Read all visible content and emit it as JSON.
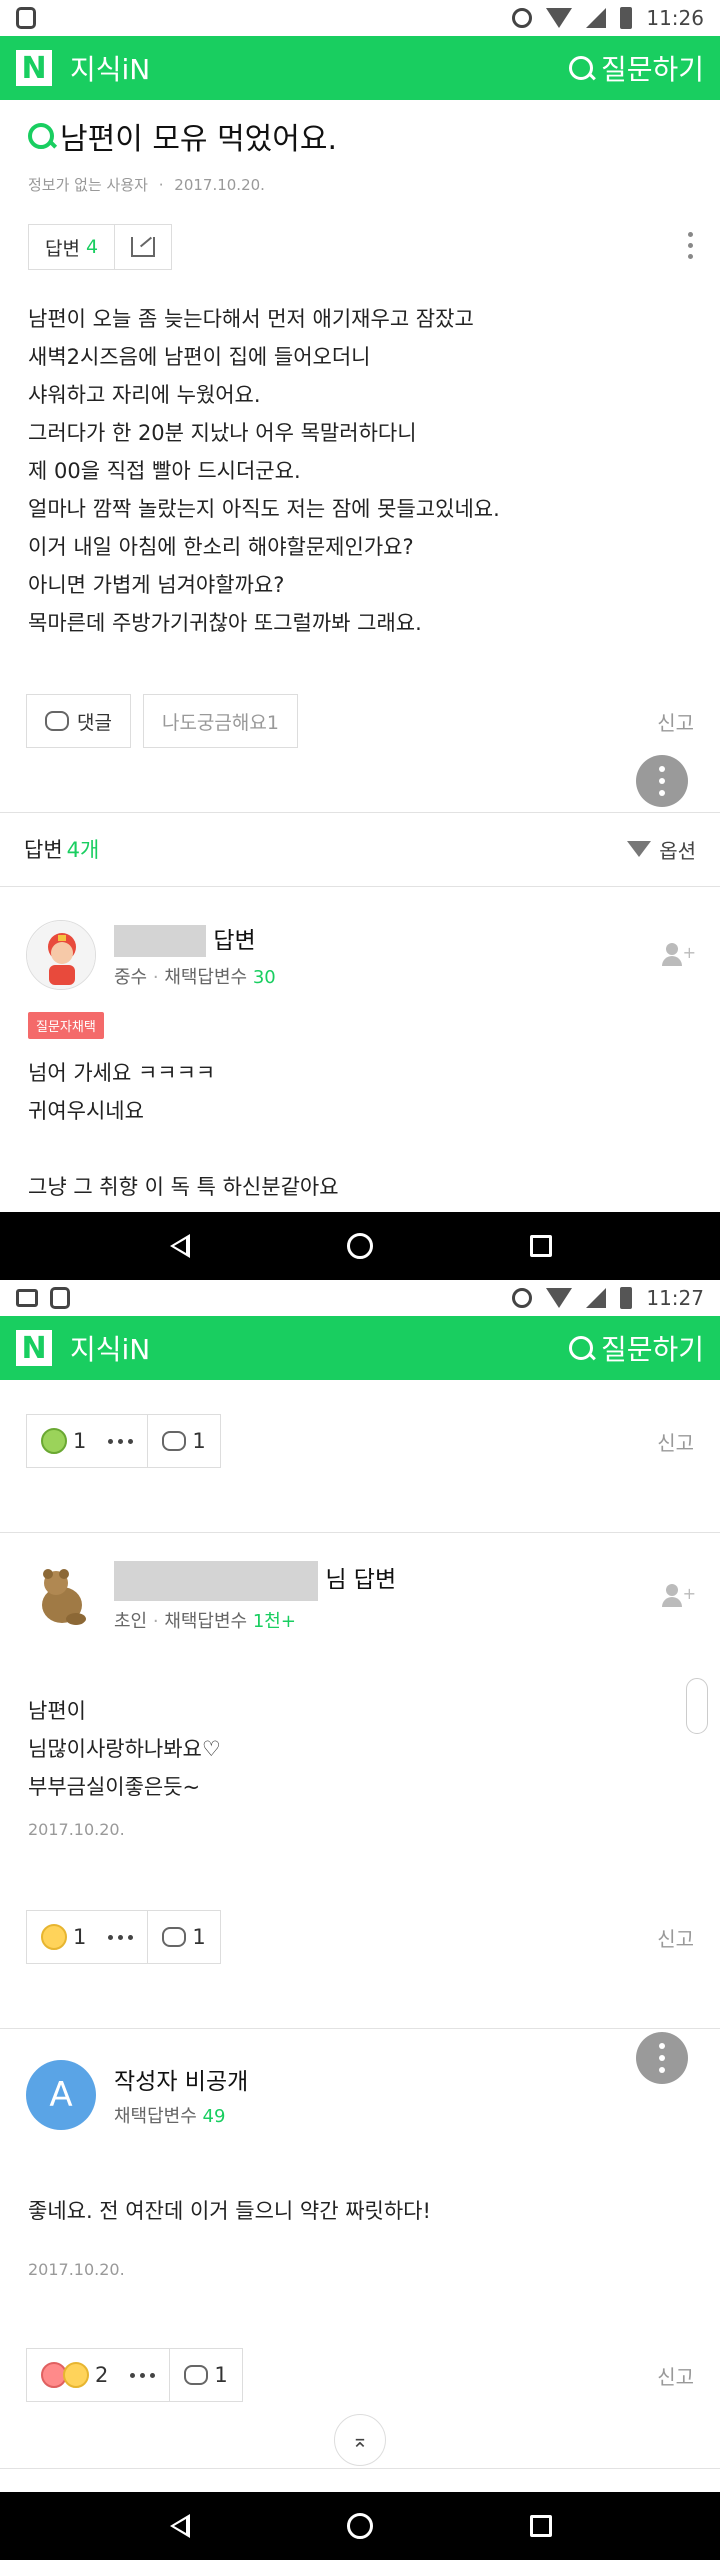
{
  "screen1": {
    "status": {
      "time": "11:26"
    },
    "appbar": {
      "logo": "N",
      "title": "지식iN",
      "ask_label": "질문하기"
    },
    "question": {
      "title": "남편이 모유 먹었어요.",
      "author": "정보가 없는 사용자",
      "date": "2017.10.20.",
      "answer_label": "답변",
      "answer_count": "4",
      "body": [
        "남편이 오늘 좀 늦는다해서 먼저 애기재우고 잠잤고",
        "새벽2시즈음에 남편이 집에 들어오더니",
        "샤워하고 자리에 누웠어요.",
        "그러다가 한 20분 지났나 어우 목말러하다니",
        "제 00을 직접 빨아 드시더군요.",
        "얼마나 깜짝 놀랐는지 아직도 저는 잠에 못들고있네요.",
        "이거 내일 아침에 한소리 해야할문제인가요?",
        "아니면 가볍게 넘겨야할까요?",
        "목마른데 주방가기귀찮아 또그럴까봐 그래요."
      ],
      "comment_label": "댓글",
      "curious_label": "나도궁금해요1",
      "report_label": "신고"
    },
    "answers_header": {
      "label": "답변",
      "count": "4개",
      "filter_label": "옵션"
    },
    "answer1": {
      "name_suffix": "답변",
      "rank": "중수",
      "adopt_label": "채택답변수",
      "adopt_count": "30",
      "tag": "질문자채택",
      "body": [
        "넘어 가세요 ㅋㅋㅋㅋ",
        "귀여우시네요",
        "",
        "그냥 그 취향 이 독 특 하신분같아요"
      ]
    }
  },
  "screen2": {
    "status": {
      "time": "11:27"
    },
    "appbar": {
      "logo": "N",
      "title": "지식iN",
      "ask_label": "질문하기"
    },
    "answer1_reactions": {
      "emoji_count": "1",
      "comment_count": "1",
      "report_label": "신고"
    },
    "answer2": {
      "name_suffix": "님 답변",
      "rank": "초인",
      "adopt_label": "채택답변수",
      "adopt_count": "1천+",
      "body": [
        "남편이",
        "님많이사랑하나봐요♡",
        "부부금실이좋은듯~"
      ],
      "date": "2017.10.20.",
      "emoji_count": "1",
      "comment_count": "1",
      "report_label": "신고"
    },
    "answer3": {
      "avatar_letter": "A",
      "name": "작성자 비공개",
      "adopt_label": "채택답변수",
      "adopt_count": "49",
      "body": "좋네요. 전 여잔데 이거 들으니 약간 짜릿하다!",
      "date": "2017.10.20.",
      "emoji_count": "2",
      "comment_count": "1",
      "report_label": "신고"
    },
    "top_button": "⌅"
  },
  "colors": {
    "brand_green": "#19ce60",
    "tag_red": "#f46a6a",
    "avatar_blue": "#5aa4e6"
  },
  "icons": [
    "bus-icon",
    "image-icon",
    "alarm-icon",
    "wifi-icon",
    "signal-icon",
    "battery-icon",
    "search-q-icon",
    "share-icon",
    "comment-icon",
    "filter-icon",
    "add-user-icon",
    "kebab-icon",
    "back-icon",
    "home-icon",
    "recent-apps-icon"
  ]
}
